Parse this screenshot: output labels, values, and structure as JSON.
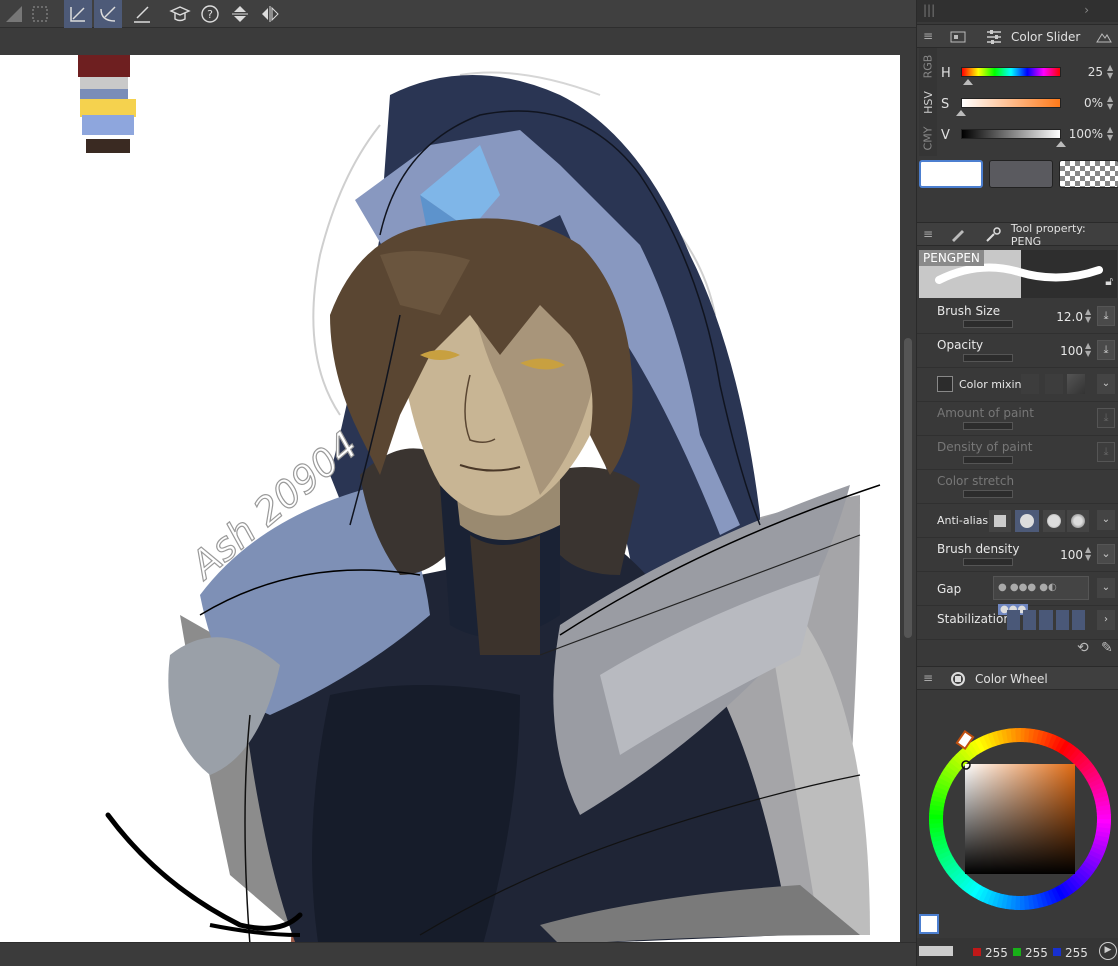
{
  "toolbar": {
    "icons": [
      "layer-mask-icon",
      "selection-icon",
      "pen-tool-icon",
      "brush-tool-icon",
      "ruler-tool-icon",
      "academy-icon",
      "help-icon",
      "flip-vertical-icon",
      "flip-horizontal-icon"
    ]
  },
  "canvas": {
    "signature": "Ash 20904"
  },
  "color_slider": {
    "title": "Color Slider",
    "side_tabs": [
      "RGB",
      "HSV",
      "CMY"
    ],
    "rows": [
      {
        "label": "H",
        "value": "25",
        "level": 0.07
      },
      {
        "label": "S",
        "value": "0%",
        "level": 0.0
      },
      {
        "label": "V",
        "value": "100%",
        "level": 1.0
      }
    ],
    "swatch_colors": {
      "main": "#ffffff",
      "sub": "#5a5a5f"
    }
  },
  "tool_property": {
    "title": "Tool property: PENG",
    "brush_name": "PENGPEN",
    "rows": [
      {
        "label": "Brush Size",
        "value": "12.0",
        "enabled": true
      },
      {
        "label": "Opacity",
        "value": "100",
        "enabled": true
      },
      {
        "label": "Color mixing",
        "value": "",
        "enabled": true
      },
      {
        "label": "Amount of paint",
        "value": "",
        "enabled": false
      },
      {
        "label": "Density of paint",
        "value": "",
        "enabled": false
      },
      {
        "label": "Color stretch",
        "value": "",
        "enabled": false
      },
      {
        "label": "Anti-aliasing",
        "value": "",
        "enabled": true
      },
      {
        "label": "Brush density",
        "value": "100",
        "enabled": true
      },
      {
        "label": "Gap",
        "value": "",
        "enabled": true
      },
      {
        "label": "Stabilization",
        "value": "",
        "enabled": true
      }
    ]
  },
  "color_wheel": {
    "title": "Color Wheel",
    "hue_color": "#e06a12",
    "rgb": {
      "r": "255",
      "g": "255",
      "b": "255"
    }
  },
  "colors": {
    "panel_bg": "#393939",
    "accent": "#4d5a78",
    "hood": "#2a3553",
    "armor_light": "#7e90b6"
  }
}
